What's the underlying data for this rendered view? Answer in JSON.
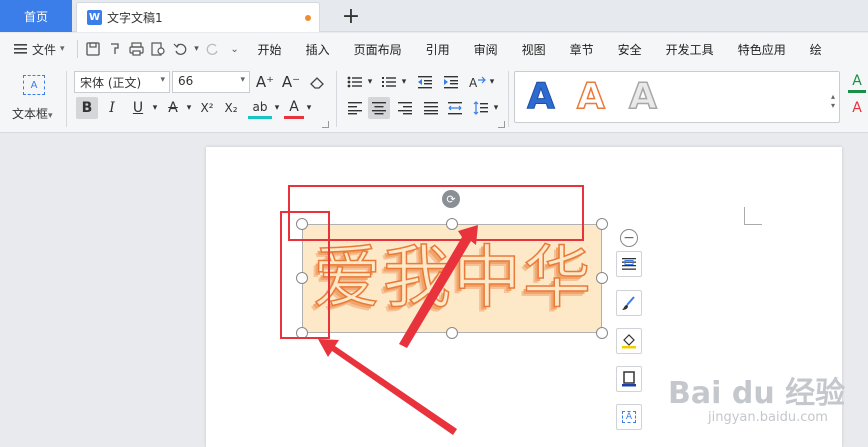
{
  "tabs": {
    "home": "首页",
    "doc_icon": "W",
    "doc_title": "文字文稿1",
    "add": "+"
  },
  "menu": {
    "file": "文件",
    "file_caret": "▾",
    "items": [
      "开始",
      "插入",
      "页面布局",
      "引用",
      "审阅",
      "视图",
      "章节",
      "安全",
      "开发工具",
      "特色应用",
      "绘"
    ]
  },
  "ribbon": {
    "textbox_icon": "A",
    "textbox_label": "文本框",
    "textbox_caret": "▾",
    "font_name": "宋体 (正文)",
    "font_size": "66",
    "grow": "A⁺",
    "shrink": "A⁻",
    "bold": "B",
    "italic": "I",
    "underline": "U",
    "strike": "A",
    "superscript": "X²",
    "subscript": "X₂",
    "highlight": "ab",
    "font_color": "A",
    "style_letters": [
      "A",
      "A",
      "A"
    ],
    "right_letters": [
      "A",
      "A"
    ]
  },
  "document": {
    "wordart_text": "爱我中华",
    "minus": "−",
    "text_box_icon": "A"
  },
  "colors": {
    "accent": "#3b7de9",
    "highlight_red": "#e8323c",
    "wordart_stroke": "#ea7a3a",
    "textbox_fill": "#fde8c8"
  },
  "watermark": {
    "main": "Bai du 经验",
    "sub": "jingyan.baidu.com"
  }
}
